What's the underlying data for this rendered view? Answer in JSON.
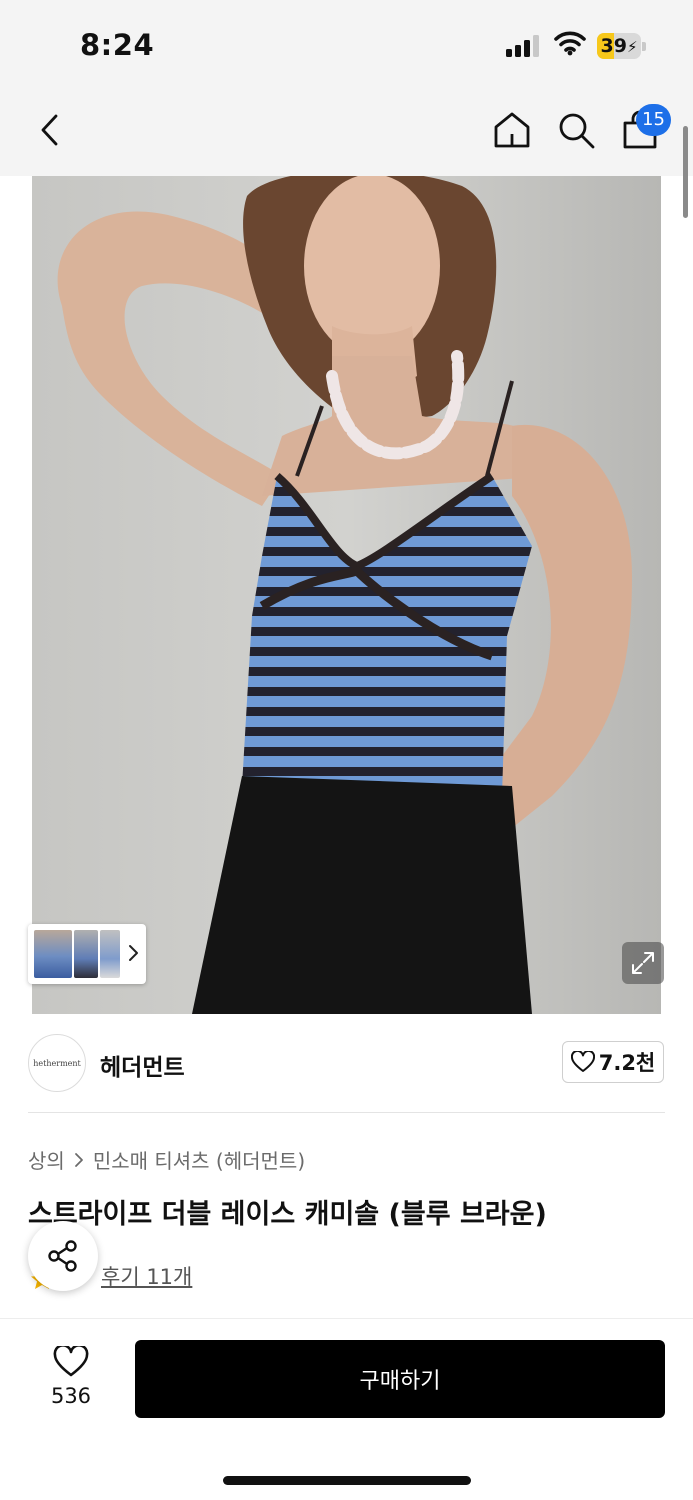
{
  "status_bar": {
    "time": "8:24",
    "battery": "39",
    "battery_level": 0.39,
    "signal_bars": 3,
    "icons": [
      "signal-icon",
      "wifi-icon",
      "battery-charging-icon"
    ]
  },
  "nav": {
    "icons": [
      "back-icon",
      "home-icon",
      "search-icon",
      "shopping-bag-icon"
    ],
    "cart_count": "15"
  },
  "gallery": {
    "thumbnails_count": 3,
    "icons": [
      "chevron-right-icon",
      "expand-icon"
    ]
  },
  "seller": {
    "logo_text": "hetherment",
    "name": "헤더먼트",
    "likes": "7.2천"
  },
  "breadcrumb": {
    "category": "상의",
    "subcategory": "민소매 티셔츠 (헤더먼트)"
  },
  "product": {
    "title": "스트라이프 더블 레이스 캐미솔 (블루 브라운)",
    "review_link": "후기 11개"
  },
  "bottom_bar": {
    "wish_count": "536",
    "buy_label": "구매하기"
  },
  "colors": {
    "accent_blue": "#1d6fe8",
    "buy_button": "#000000",
    "battery_yellow": "#f7c81b",
    "star": "#f5b301"
  }
}
